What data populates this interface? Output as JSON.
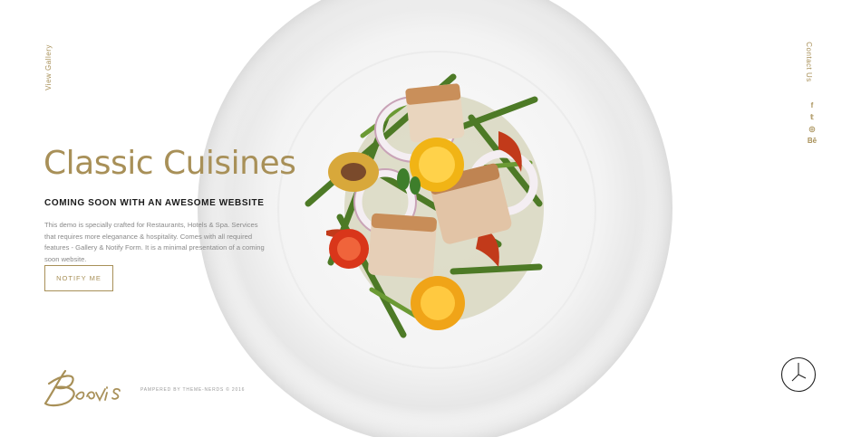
{
  "side_left": {
    "label": "View Gallery"
  },
  "side_right": {
    "label": "Contact Us"
  },
  "social": [
    {
      "name": "facebook-icon",
      "glyph": "f"
    },
    {
      "name": "twitter-icon",
      "glyph": "𝕥"
    },
    {
      "name": "dribbble-icon",
      "glyph": "◎"
    },
    {
      "name": "behance-icon",
      "glyph": "Bē"
    }
  ],
  "hero": {
    "title": "Classic Cuisines",
    "subtitle": "COMING SOON WITH AN AWESOME WEBSITE",
    "description": "This demo is specially crafted for Restaurants, Hotels & Spa. Services that requires more eleganance & hospitality. Comes with all required features - Gallery & Notify Form. It is a minimal presentation of a coming soon website.",
    "button_label": "NOTIFY ME"
  },
  "footer": {
    "logo_text": "Beavis",
    "credits": "PAMPERED BY THEME-NERDS © 2016"
  },
  "colors": {
    "accent": "#a89058",
    "text_dark": "#1a1a1a",
    "text_muted": "#8a8a8a",
    "background": "#ffffff"
  }
}
